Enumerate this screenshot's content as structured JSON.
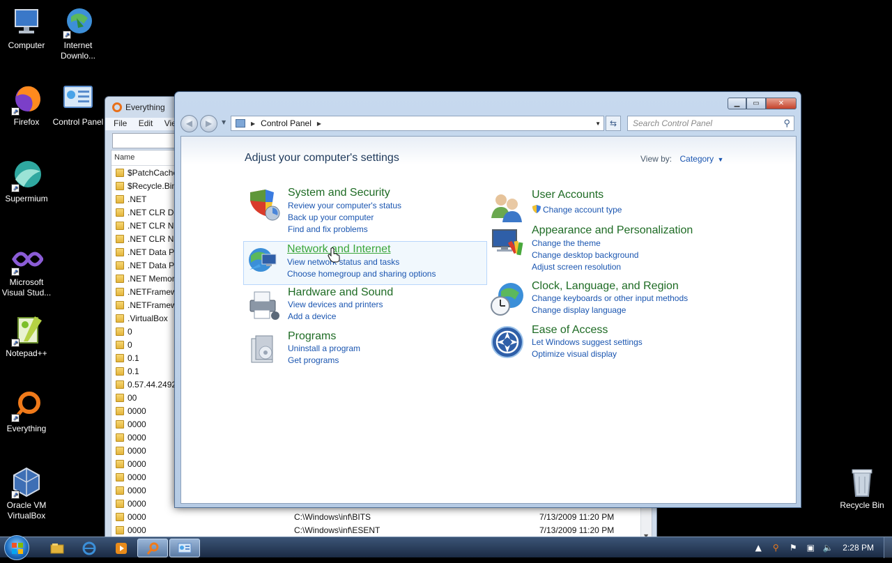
{
  "desktop": {
    "icons": [
      {
        "label": "Computer"
      },
      {
        "label": "Internet Downlo..."
      },
      {
        "label": "Firefox"
      },
      {
        "label": "Control Panel"
      },
      {
        "label": "Supermium"
      },
      {
        "label": "Microsoft Visual Stud..."
      },
      {
        "label": "Notepad++"
      },
      {
        "label": "Everything"
      },
      {
        "label": "Oracle VM VirtualBox"
      },
      {
        "label": "Recycle Bin"
      }
    ]
  },
  "everything": {
    "title": "Everything",
    "menu": [
      "File",
      "Edit",
      "View"
    ],
    "column_name": "Name",
    "rows": [
      {
        "name": "$PatchCache$"
      },
      {
        "name": "$Recycle.Bin"
      },
      {
        "name": ".NET"
      },
      {
        "name": ".NET CLR Data"
      },
      {
        "name": ".NET CLR Networking"
      },
      {
        "name": ".NET CLR Networking"
      },
      {
        "name": ".NET Data Provider"
      },
      {
        "name": ".NET Data Provider"
      },
      {
        "name": ".NET Memory"
      },
      {
        "name": ".NETFramework"
      },
      {
        "name": ".NETFramework"
      },
      {
        "name": ".VirtualBox"
      },
      {
        "name": "0"
      },
      {
        "name": "0"
      },
      {
        "name": "0.1"
      },
      {
        "name": "0.1"
      },
      {
        "name": "0.57.44.2492"
      },
      {
        "name": "00"
      },
      {
        "name": "0000"
      },
      {
        "name": "0000"
      },
      {
        "name": "0000"
      },
      {
        "name": "0000"
      },
      {
        "name": "0000"
      },
      {
        "name": "0000"
      },
      {
        "name": "0000"
      },
      {
        "name": "0000"
      },
      {
        "name": "0000",
        "path": "C:\\Windows\\inf\\BITS",
        "date": "7/13/2009 11:20 PM"
      },
      {
        "name": "0000",
        "path": "C:\\Windows\\inf\\ESENT",
        "date": "7/13/2009 11:20 PM"
      }
    ]
  },
  "control_panel": {
    "address": "Control Panel",
    "search_placeholder": "Search Control Panel",
    "heading": "Adjust your computer's settings",
    "view_by_label": "View by:",
    "view_by_value": "Category",
    "categories": [
      {
        "title": "System and Security",
        "links": [
          "Review your computer's status",
          "Back up your computer",
          "Find and fix problems"
        ]
      },
      {
        "title": "Network and Internet",
        "links": [
          "View network status and tasks",
          "Choose homegroup and sharing options"
        ]
      },
      {
        "title": "Hardware and Sound",
        "links": [
          "View devices and printers",
          "Add a device"
        ]
      },
      {
        "title": "Programs",
        "links": [
          "Uninstall a program",
          "Get programs"
        ]
      },
      {
        "title": "User Accounts",
        "links": [
          "Change account type"
        ]
      },
      {
        "title": "Appearance and Personalization",
        "links": [
          "Change the theme",
          "Change desktop background",
          "Adjust screen resolution"
        ]
      },
      {
        "title": "Clock, Language, and Region",
        "links": [
          "Change keyboards or other input methods",
          "Change display language"
        ]
      },
      {
        "title": "Ease of Access",
        "links": [
          "Let Windows suggest settings",
          "Optimize visual display"
        ]
      }
    ]
  },
  "taskbar": {
    "clock": "2:28 PM"
  },
  "colors": {
    "category_title": "#1e6b24",
    "link": "#1a55b0",
    "hover_title": "#3aa63a"
  }
}
